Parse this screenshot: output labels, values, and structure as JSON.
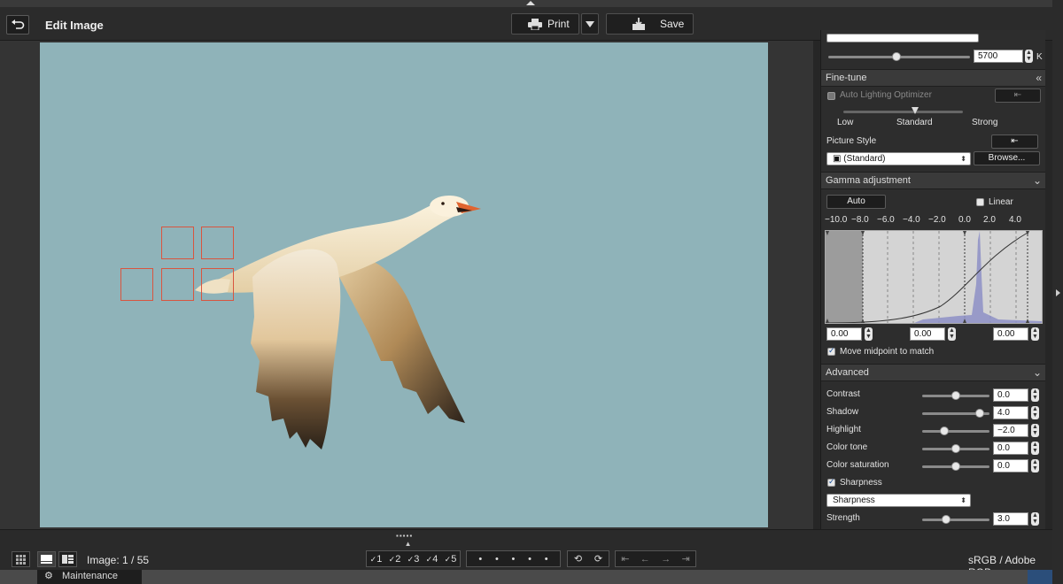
{
  "header": {
    "title": "Edit Image",
    "print_label": "Print",
    "save_label": "Save"
  },
  "panel": {
    "color_temp": {
      "value": "5700",
      "unit": "K"
    },
    "fine_tune": {
      "heading": "Fine-tune",
      "alo_label": "Auto Lighting Optimizer",
      "alo_levels": [
        "Low",
        "Standard",
        "Strong"
      ],
      "picture_style_label": "Picture Style",
      "picture_style_value": "(Standard)",
      "browse_label": "Browse..."
    },
    "gamma": {
      "heading": "Gamma adjustment",
      "auto_label": "Auto",
      "linear_label": "Linear",
      "ticks": [
        "−10.0",
        "−8.0",
        "−6.0",
        "−4.0",
        "−2.0",
        "0.0",
        "2.0",
        "4.0"
      ],
      "values": [
        "0.00",
        "0.00",
        "0.00"
      ],
      "midpoint_label": "Move midpoint to match"
    },
    "advanced": {
      "heading": "Advanced",
      "rows": [
        {
          "label": "Contrast",
          "value": "0.0",
          "level": 0.5
        },
        {
          "label": "Shadow",
          "value": "4.0",
          "level": 0.85
        },
        {
          "label": "Highlight",
          "value": "−2.0",
          "level": 0.33
        },
        {
          "label": "Color tone",
          "value": "0.0",
          "level": 0.5
        },
        {
          "label": "Color saturation",
          "value": "0.0",
          "level": 0.5
        }
      ],
      "sharpness_check_label": "Sharpness",
      "sharpness_mode": "Sharpness",
      "strength_label": "Strength",
      "strength_value": "3.0",
      "strength_level": 0.35
    }
  },
  "bottom": {
    "image_count": "Image: 1 / 55",
    "ratings": [
      "1",
      "2",
      "3",
      "4",
      "5"
    ],
    "color_profile": "sRGB / Adobe RGB"
  },
  "taskbar": {
    "maintenance_label": "Maintenance"
  },
  "colors": {
    "sky": "#8fb3b9",
    "af_frame": "#d9553f"
  }
}
